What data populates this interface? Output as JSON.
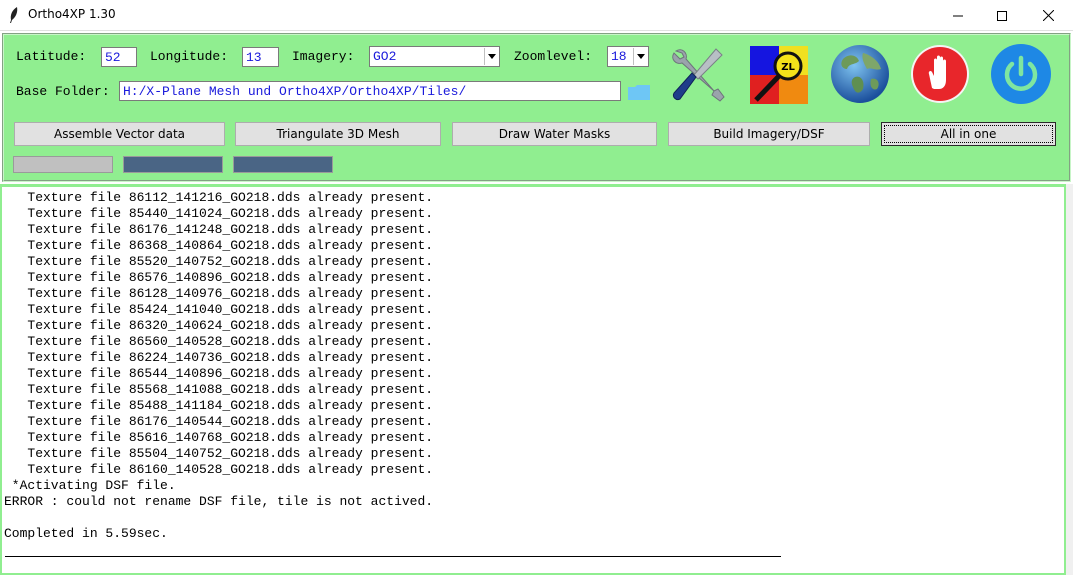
{
  "window": {
    "title": "Ortho4XP 1.30"
  },
  "form": {
    "latitude": {
      "label": "Latitude:",
      "value": "52"
    },
    "longitude": {
      "label": "Longitude:",
      "value": "13"
    },
    "imagery": {
      "label": "Imagery:",
      "value": "GO2"
    },
    "zoomlevel": {
      "label": "Zoomlevel:",
      "value": "18"
    },
    "base_folder": {
      "label": "Base Folder:",
      "value": "H:/X-Plane Mesh und Ortho4XP/Ortho4XP/Tiles/"
    }
  },
  "toolbar": {
    "icons": [
      "tools-icon",
      "zoomlevel-map-icon",
      "earth-icon",
      "stop-hand-icon",
      "power-icon"
    ],
    "zl_badge": "ZL"
  },
  "actions": {
    "assemble_vector": "Assemble Vector data",
    "triangulate_mesh": "Triangulate 3D Mesh",
    "draw_water_masks": "Draw Water Masks",
    "build_imagery_dsf": "Build Imagery/DSF",
    "all_in_one": "All in one"
  },
  "progress": [
    {
      "value": 0,
      "color": "#c0c0c0"
    },
    {
      "value": 1,
      "color": "#4a6585"
    },
    {
      "value": 1,
      "color": "#4a6585"
    }
  ],
  "colors": {
    "panel_bg": "#90ee90",
    "entry_text": "#1a1adb",
    "stop_red": "#e8262b",
    "power_blue": "#1e88e5"
  },
  "console": {
    "lines": [
      "   Texture file 86112_141216_GO218.dds already present.",
      "   Texture file 85440_141024_GO218.dds already present.",
      "   Texture file 86176_141248_GO218.dds already present.",
      "   Texture file 86368_140864_GO218.dds already present.",
      "   Texture file 85520_140752_GO218.dds already present.",
      "   Texture file 86576_140896_GO218.dds already present.",
      "   Texture file 86128_140976_GO218.dds already present.",
      "   Texture file 85424_141040_GO218.dds already present.",
      "   Texture file 86320_140624_GO218.dds already present.",
      "   Texture file 86560_140528_GO218.dds already present.",
      "   Texture file 86224_140736_GO218.dds already present.",
      "   Texture file 86544_140896_GO218.dds already present.",
      "   Texture file 85568_141088_GO218.dds already present.",
      "   Texture file 85488_141184_GO218.dds already present.",
      "   Texture file 86176_140544_GO218.dds already present.",
      "   Texture file 85616_140768_GO218.dds already present.",
      "   Texture file 85504_140752_GO218.dds already present.",
      "   Texture file 86160_140528_GO218.dds already present.",
      " *Activating DSF file.",
      "ERROR : could not rename DSF file, tile is not actived.",
      "",
      "Completed in 5.59sec."
    ]
  }
}
